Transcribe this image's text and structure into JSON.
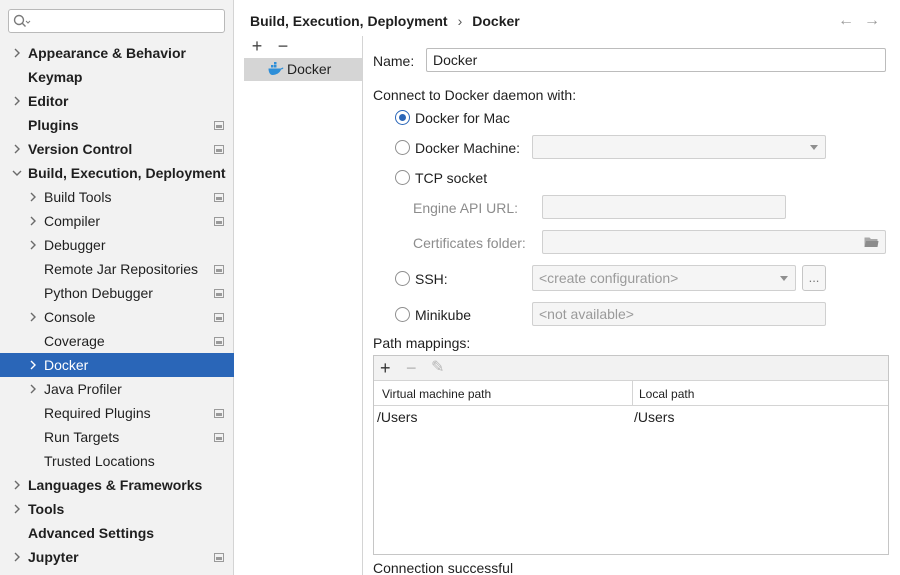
{
  "sidebar": {
    "search_placeholder": "",
    "items": [
      {
        "label": "Appearance & Behavior",
        "level": 0,
        "chevron": "right",
        "project": false
      },
      {
        "label": "Keymap",
        "level": 0,
        "chevron": "none",
        "project": false
      },
      {
        "label": "Editor",
        "level": 0,
        "chevron": "right",
        "project": false
      },
      {
        "label": "Plugins",
        "level": 0,
        "chevron": "none",
        "project": true
      },
      {
        "label": "Version Control",
        "level": 0,
        "chevron": "right",
        "project": true
      },
      {
        "label": "Build, Execution, Deployment",
        "level": 0,
        "chevron": "down",
        "project": false
      },
      {
        "label": "Build Tools",
        "level": 1,
        "chevron": "right",
        "project": true
      },
      {
        "label": "Compiler",
        "level": 1,
        "chevron": "right",
        "project": true
      },
      {
        "label": "Debugger",
        "level": 1,
        "chevron": "right",
        "project": false
      },
      {
        "label": "Remote Jar Repositories",
        "level": 1,
        "chevron": "none",
        "project": true
      },
      {
        "label": "Python Debugger",
        "level": 1,
        "chevron": "none",
        "project": true
      },
      {
        "label": "Console",
        "level": 1,
        "chevron": "right",
        "project": true
      },
      {
        "label": "Coverage",
        "level": 1,
        "chevron": "none",
        "project": true
      },
      {
        "label": "Docker",
        "level": 1,
        "chevron": "right",
        "project": false,
        "selected": true
      },
      {
        "label": "Java Profiler",
        "level": 1,
        "chevron": "right",
        "project": false
      },
      {
        "label": "Required Plugins",
        "level": 1,
        "chevron": "none",
        "project": true
      },
      {
        "label": "Run Targets",
        "level": 1,
        "chevron": "none",
        "project": true
      },
      {
        "label": "Trusted Locations",
        "level": 1,
        "chevron": "none",
        "project": false
      },
      {
        "label": "Languages & Frameworks",
        "level": 0,
        "chevron": "right",
        "project": false
      },
      {
        "label": "Tools",
        "level": 0,
        "chevron": "right",
        "project": false
      },
      {
        "label": "Advanced Settings",
        "level": 0,
        "chevron": "none",
        "project": false
      },
      {
        "label": "Jupyter",
        "level": 0,
        "chevron": "right",
        "project": true
      }
    ]
  },
  "header": {
    "crumb_parent": "Build, Execution, Deployment",
    "crumb_separator": "›",
    "crumb_current": "Docker",
    "back_icon": "←",
    "forward_icon": "→"
  },
  "list": {
    "add_icon": "+",
    "remove_icon": "−",
    "items": [
      {
        "label": "Docker"
      }
    ]
  },
  "form": {
    "name_label": "Name:",
    "name_value": "Docker",
    "connect_label": "Connect to Docker daemon with:",
    "docker_for_mac": "Docker for Mac",
    "docker_machine": "Docker Machine:",
    "docker_machine_value": "",
    "tcp_socket": "TCP socket",
    "engine_api_url": "Engine API URL:",
    "engine_api_url_value": "",
    "certificates_folder": "Certificates folder:",
    "certificates_folder_value": "",
    "ssh": "SSH:",
    "ssh_value": "<create configuration>",
    "ssh_more": "...",
    "minikube": "Minikube",
    "minikube_value": "<not available>",
    "path_mappings": "Path mappings:",
    "selected_option": "docker_for_mac"
  },
  "mappings": {
    "add_icon": "+",
    "remove_icon": "−",
    "edit_icon": "✎",
    "col_vm": "Virtual machine path",
    "col_local": "Local path",
    "rows": [
      {
        "vm": "/Users",
        "local": "/Users"
      }
    ]
  },
  "status": "Connection successful",
  "colors": {
    "accent": "#2a66b8",
    "sidebar_bg": "#f2f2f2"
  }
}
